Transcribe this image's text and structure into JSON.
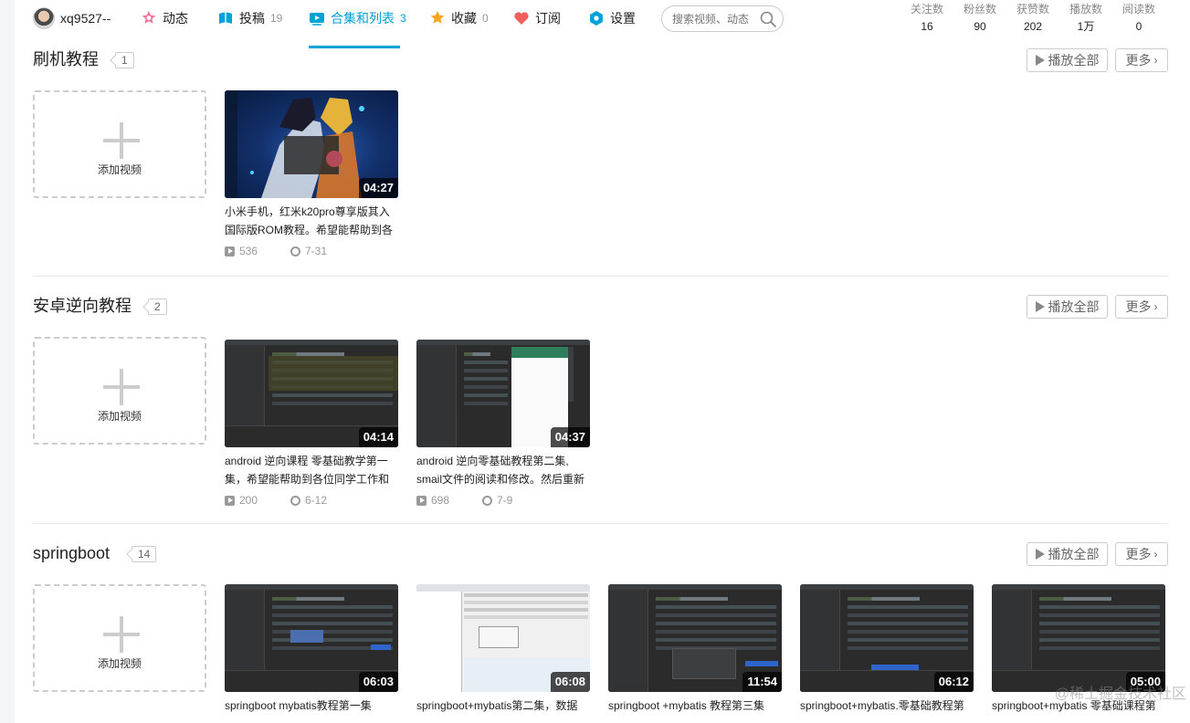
{
  "user": {
    "name": "xq9527--"
  },
  "nav": {
    "items": [
      {
        "label": "动态",
        "count": "",
        "icon": "dynamic-icon"
      },
      {
        "label": "投稿",
        "count": "19",
        "icon": "upload-icon"
      },
      {
        "label": "合集和列表",
        "count": "3",
        "icon": "collection-icon"
      },
      {
        "label": "收藏",
        "count": "0",
        "icon": "favorite-icon"
      },
      {
        "label": "订阅",
        "count": "",
        "icon": "subscribe-icon"
      },
      {
        "label": "设置",
        "count": "",
        "icon": "settings-icon"
      }
    ],
    "active_index": 2
  },
  "search": {
    "placeholder": "搜索视频、动态"
  },
  "stats": [
    {
      "label": "关注数",
      "value": "16"
    },
    {
      "label": "粉丝数",
      "value": "90"
    },
    {
      "label": "获赞数",
      "value": "202"
    },
    {
      "label": "播放数",
      "value": "1万"
    },
    {
      "label": "阅读数",
      "value": "0"
    }
  ],
  "labels": {
    "play_all": "播放全部",
    "more": "更多",
    "add_video": "添加视频"
  },
  "sections": [
    {
      "title": "刷机教程",
      "count": "1",
      "videos": [
        {
          "title": "小米手机，红米k20pro尊享版其入国际版ROM教程。希望能帮助到各",
          "duration": "04:27",
          "plays": "536",
          "date": "7-31",
          "thumb": "anime"
        }
      ]
    },
    {
      "title": "安卓逆向教程",
      "count": "2",
      "videos": [
        {
          "title": "android 逆向课程 零基础教学第一集，希望能帮助到各位同学工作和",
          "duration": "04:14",
          "plays": "200",
          "date": "6-12",
          "thumb": "ide"
        },
        {
          "title": "android 逆向零基础教程第二集, smail文件的阅读和修改。然后重新",
          "duration": "04:37",
          "plays": "698",
          "date": "7-9",
          "thumb": "ide-phone"
        }
      ]
    },
    {
      "title": "springboot",
      "count": "14",
      "videos": [
        {
          "title": "springboot mybatis教程第一集",
          "duration": "06:03",
          "plays": "",
          "date": "",
          "thumb": "ide"
        },
        {
          "title": "springboot+mybatis第二集，数据",
          "duration": "06:08",
          "plays": "",
          "date": "",
          "thumb": "win"
        },
        {
          "title": "springboot +mybatis 教程第三集",
          "duration": "11:54",
          "plays": "",
          "date": "",
          "thumb": "ide"
        },
        {
          "title": "springboot+mybatis.零基础教程第",
          "duration": "06:12",
          "plays": "",
          "date": "",
          "thumb": "ide"
        },
        {
          "title": "springboot+mybatis 零基础课程第",
          "duration": "05:00",
          "plays": "",
          "date": "",
          "thumb": "ide"
        }
      ]
    }
  ],
  "watermark": "@稀土掘金技术社区",
  "colors": {
    "accent": "#00a1d6",
    "text": "#222222",
    "muted": "#999999"
  }
}
